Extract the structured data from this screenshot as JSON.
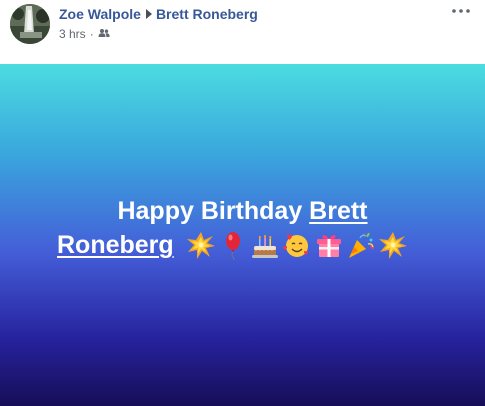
{
  "post": {
    "author": "Zoe Walpole",
    "recipient": "Brett Roneberg",
    "time": "3 hrs",
    "separator": "·",
    "audience_icon": "friends-icon",
    "more_icon": "more-horizontal-icon"
  },
  "banner": {
    "text_prefix": "Happy Birthday ",
    "tag_first": "Brett",
    "tag_last": "Roneberg",
    "emojis": [
      "collision",
      "balloon",
      "birthday-cake",
      "smiling-face-with-hearts",
      "wrapped-gift",
      "party-popper",
      "collision"
    ]
  }
}
